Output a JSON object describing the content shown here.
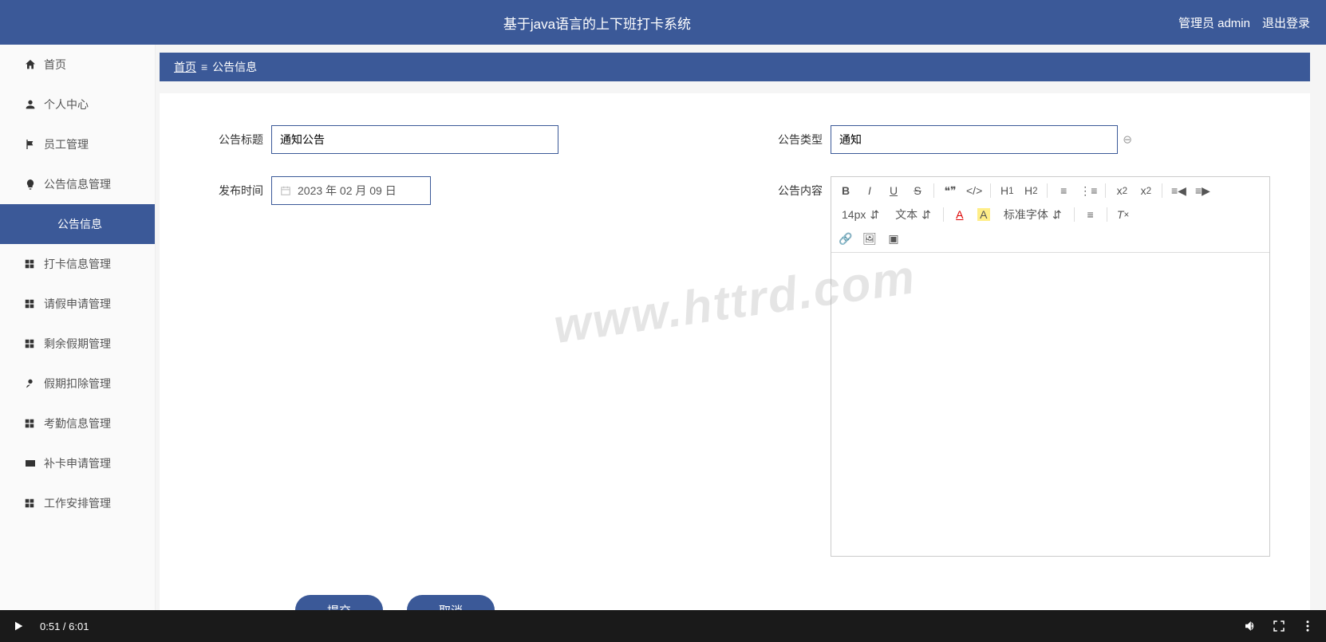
{
  "header": {
    "title": "基于java语言的上下班打卡系统",
    "admin_label": "管理员 admin",
    "logout_label": "退出登录"
  },
  "sidebar": {
    "items": [
      {
        "id": "home",
        "label": "首页",
        "icon": "home"
      },
      {
        "id": "personal",
        "label": "个人中心",
        "icon": "person"
      },
      {
        "id": "employee",
        "label": "员工管理",
        "icon": "flag"
      },
      {
        "id": "announcement-mgmt",
        "label": "公告信息管理",
        "icon": "bulb"
      },
      {
        "id": "announcement-info",
        "label": "公告信息",
        "icon": "",
        "sub": true,
        "active": true
      },
      {
        "id": "clockin-mgmt",
        "label": "打卡信息管理",
        "icon": "grid"
      },
      {
        "id": "leave-mgmt",
        "label": "请假申请管理",
        "icon": "grid"
      },
      {
        "id": "remaining-mgmt",
        "label": "剩余假期管理",
        "icon": "grid"
      },
      {
        "id": "deduct-mgmt",
        "label": "假期扣除管理",
        "icon": "deduct"
      },
      {
        "id": "attendance-mgmt",
        "label": "考勤信息管理",
        "icon": "grid"
      },
      {
        "id": "supplement-mgmt",
        "label": "补卡申请管理",
        "icon": "card"
      },
      {
        "id": "work-mgmt",
        "label": "工作安排管理",
        "icon": "grid"
      }
    ]
  },
  "breadcrumb": {
    "home": "首页",
    "current": "公告信息"
  },
  "form": {
    "title_label": "公告标题",
    "title_value": "通知公告",
    "type_label": "公告类型",
    "type_value": "通知",
    "date_label": "发布时间",
    "date_value": "2023 年 02 月 09 日",
    "content_label": "公告内容",
    "editor": {
      "font_size": "14px",
      "text_mode": "文本",
      "font_family": "标准字体"
    }
  },
  "buttons": {
    "submit": "提交",
    "cancel": "取消"
  },
  "watermark": "www.httrd.com",
  "video": {
    "current": "0:51",
    "total": "6:01"
  }
}
